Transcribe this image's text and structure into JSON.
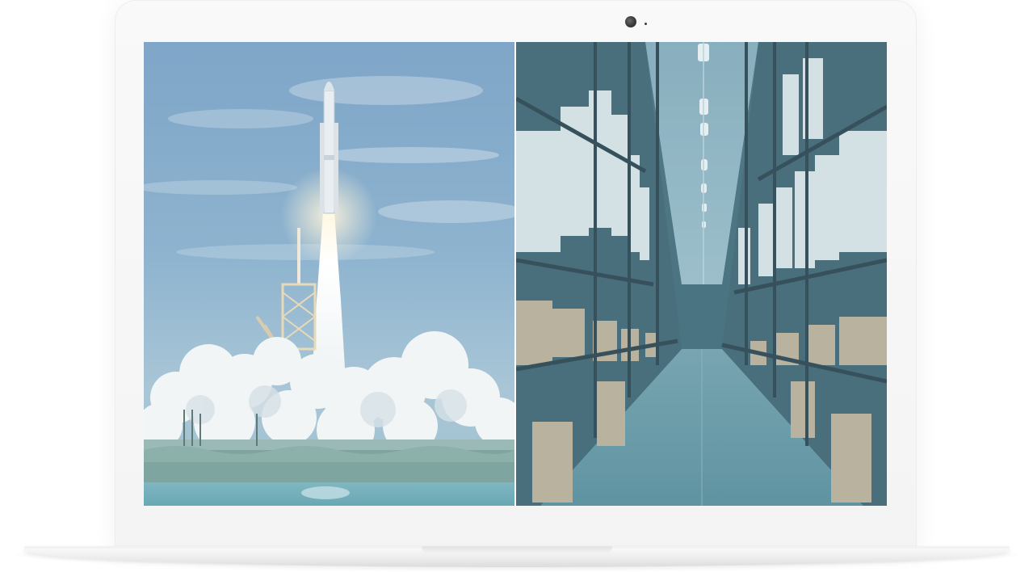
{
  "device": {
    "type": "laptop",
    "color": "#f6f6f6"
  },
  "screen": {
    "tint_color": "#6fa6b8",
    "panels": [
      {
        "id": "rocket-launch",
        "subject": "rocket-launch-photo"
      },
      {
        "id": "warehouse-aisle",
        "subject": "warehouse-shelves-photo"
      }
    ]
  }
}
